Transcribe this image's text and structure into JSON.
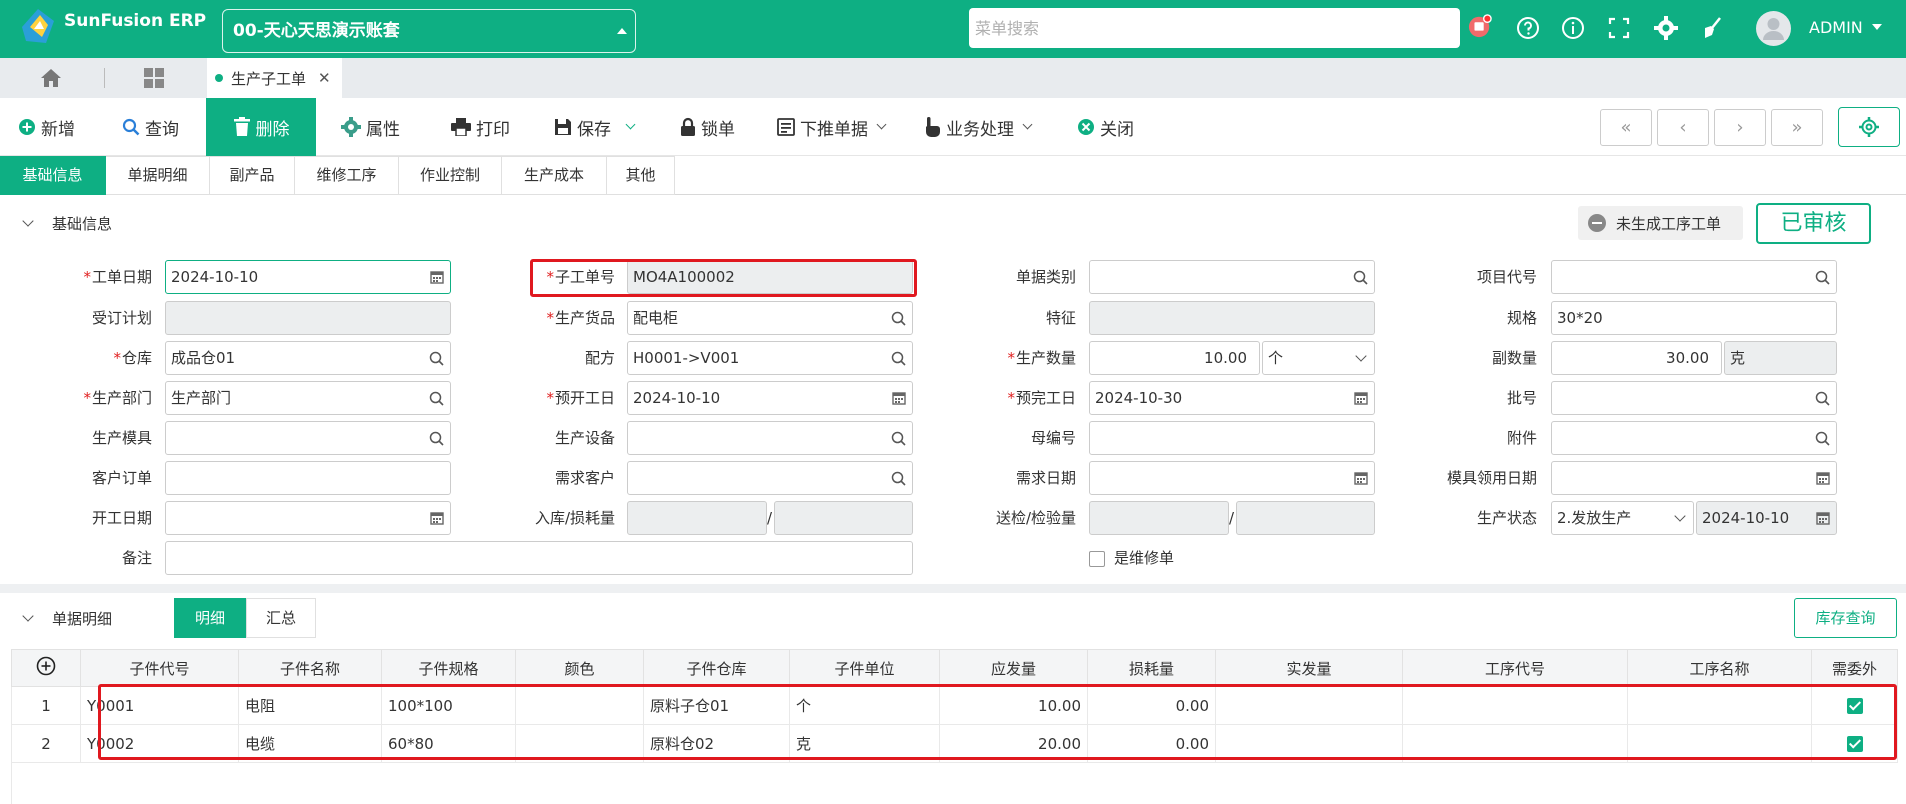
{
  "app": {
    "name": "SunFusion ERP",
    "account": "00-天心天思演示账套",
    "search_placeholder": "菜单搜索",
    "user": "ADMIN"
  },
  "colors": {
    "brand": "#0eaf83",
    "danger": "#e0181f"
  },
  "window_tabs": [
    {
      "label": "生产子工单"
    }
  ],
  "toolbar": {
    "new": "新增",
    "query": "查询",
    "delete": "删除",
    "attr": "属性",
    "print": "打印",
    "save": "保存",
    "lock": "锁单",
    "push": "下推单据",
    "biz": "业务处理",
    "close": "关闭"
  },
  "subtabs": [
    "基础信息",
    "单据明细",
    "副产品",
    "维修工序",
    "作业控制",
    "生产成本",
    "其他"
  ],
  "basic": {
    "title": "基础信息",
    "status_task": "未生成工序工单",
    "status_audit": "已审核",
    "labels": {
      "work_date": "工单日期",
      "sub_no": "子工单号",
      "doc_type": "单据类别",
      "project": "项目代号",
      "order_plan": "受订计划",
      "product": "生产货品",
      "feature": "特征",
      "spec": "规格",
      "warehouse": "仓库",
      "recipe": "配方",
      "qty": "生产数量",
      "sub_qty": "副数量",
      "dept": "生产部门",
      "plan_start": "预开工日",
      "plan_end": "预完工日",
      "batch": "批号",
      "mold": "生产模具",
      "equip": "生产设备",
      "parent_no": "母编号",
      "attach": "附件",
      "cust_order": "客户订单",
      "demand_cust": "需求客户",
      "demand_date": "需求日期",
      "mold_date": "模具领用日期",
      "start_date": "开工日期",
      "in_loss": "入库/损耗量",
      "send_check": "送检/检验量",
      "prod_status": "生产状态",
      "remark": "备注",
      "repair": "是维修单"
    },
    "values": {
      "work_date": "2024-10-10",
      "sub_no": "MO4A100002",
      "product": "配电柜",
      "spec": "30*20",
      "warehouse": "成品仓01",
      "recipe": "H0001->V001",
      "qty": "10.00",
      "qty_unit": "个",
      "sub_qty": "30.00",
      "sub_unit": "克",
      "dept": "生产部门",
      "plan_start": "2024-10-10",
      "plan_end": "2024-10-30",
      "prod_status": "2.发放生产",
      "status_date": "2024-10-10"
    }
  },
  "detail": {
    "title": "单据明细",
    "seg": [
      "明细",
      "汇总"
    ],
    "stock_query": "库存查询",
    "columns": [
      "子件代号",
      "子件名称",
      "子件规格",
      "颜色",
      "子件仓库",
      "子件单位",
      "应发量",
      "损耗量",
      "实发量",
      "工序代号",
      "工序名称",
      "需委外"
    ],
    "rows": [
      {
        "no": "1",
        "code": "Y0001",
        "name": "电阻",
        "spec": "100*100",
        "color": "",
        "wh": "原料子仓01",
        "unit": "个",
        "qty": "10.00",
        "loss": "0.00",
        "actual": "",
        "op_code": "",
        "op_name": "",
        "outsource": true
      },
      {
        "no": "2",
        "code": "Y0002",
        "name": "电缆",
        "spec": "60*80",
        "color": "",
        "wh": "原料仓02",
        "unit": "克",
        "qty": "20.00",
        "loss": "0.00",
        "actual": "",
        "op_code": "",
        "op_name": "",
        "outsource": true
      }
    ]
  }
}
